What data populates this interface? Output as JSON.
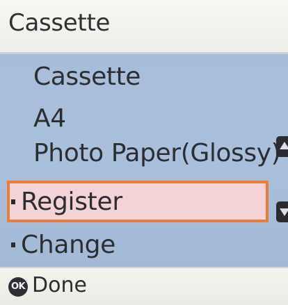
{
  "title": "Cassette",
  "info": {
    "source": "Cassette",
    "size": "A4",
    "type": "Photo Paper(Glossy)"
  },
  "options": [
    {
      "label": "Register",
      "selected": true
    },
    {
      "label": "Change",
      "selected": false
    }
  ],
  "scroll": {
    "up_icon": "scroll-up-arrow",
    "down_icon": "scroll-down-arrow"
  },
  "footer": {
    "button_icon_text": "OK",
    "action_label": "Done"
  },
  "colors": {
    "title_bg": "#f4f4ef",
    "content_bg": "#a8bfdb",
    "selection_border": "#ea7c3c",
    "selection_fill": "#f3d3d5",
    "text": "#2b2d31"
  }
}
